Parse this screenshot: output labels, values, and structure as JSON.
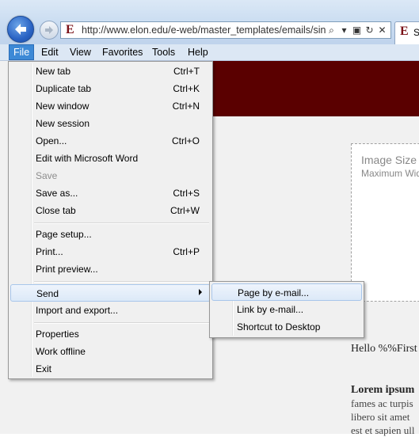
{
  "browser": {
    "url": "http://www.elon.edu/e-web/master_templates/emails/sin",
    "favicon_letter": "E",
    "tab_title": "S"
  },
  "menubar": [
    "File",
    "Edit",
    "View",
    "Favorites",
    "Tools",
    "Help"
  ],
  "file_menu": [
    {
      "label": "New tab",
      "shortcut": "Ctrl+T"
    },
    {
      "label": "Duplicate tab",
      "shortcut": "Ctrl+K"
    },
    {
      "label": "New window",
      "shortcut": "Ctrl+N"
    },
    {
      "label": "New session",
      "shortcut": ""
    },
    {
      "label": "Open...",
      "shortcut": "Ctrl+O"
    },
    {
      "label": "Edit with Microsoft Word",
      "shortcut": ""
    },
    {
      "label": "Save",
      "shortcut": ""
    },
    {
      "label": "Save as...",
      "shortcut": "Ctrl+S"
    },
    {
      "label": "Close tab",
      "shortcut": "Ctrl+W"
    },
    {
      "label": "Page setup...",
      "shortcut": ""
    },
    {
      "label": "Print...",
      "shortcut": "Ctrl+P"
    },
    {
      "label": "Print preview...",
      "shortcut": ""
    },
    {
      "label": "Send",
      "shortcut": ""
    },
    {
      "label": "Import and export...",
      "shortcut": ""
    },
    {
      "label": "Properties",
      "shortcut": ""
    },
    {
      "label": "Work offline",
      "shortcut": ""
    },
    {
      "label": "Exit",
      "shortcut": ""
    }
  ],
  "send_submenu": [
    "Page by e-mail...",
    "Link by e-mail...",
    "Shortcut to Desktop"
  ],
  "page": {
    "image_title": "Image Size",
    "image_sub": "Maximum Wid",
    "greeting": "Hello %%First N",
    "lorem_bold": "Lorem ipsum",
    "lorem_lines": [
      "fames ac turpis",
      "libero sit amet",
      "est et sapien ull"
    ]
  },
  "colors": {
    "banner": "#5a0000",
    "menu_active": "#3d89d6"
  }
}
